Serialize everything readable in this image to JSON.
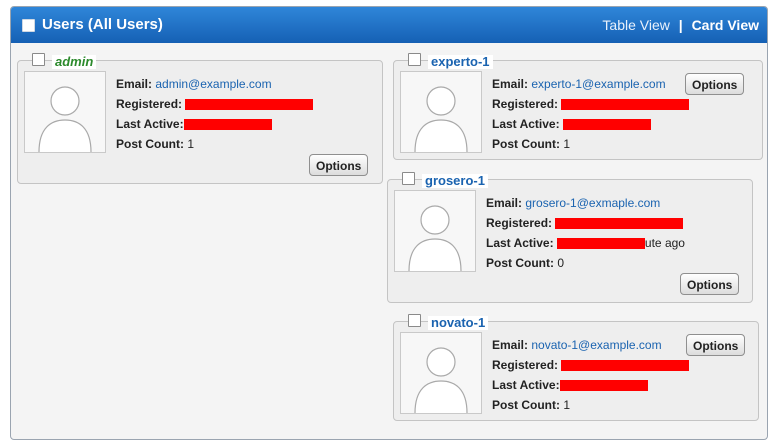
{
  "header": {
    "title": "Users (All Users)",
    "table_view": "Table View",
    "separator": "|",
    "card_view": "Card View"
  },
  "labels": {
    "email": "Email:",
    "registered": "Registered:",
    "last_active": "Last Active:",
    "post_count": "Post Count:",
    "options": "Options"
  },
  "users": [
    {
      "name": "admin",
      "email": "admin@example.com",
      "last_active_tail": "",
      "post_count": "1"
    },
    {
      "name": "experto-1",
      "email": "experto-1@example.com",
      "last_active_tail": "",
      "post_count": "1"
    },
    {
      "name": "grosero-1",
      "email": "grosero-1@exmaple.com",
      "last_active_tail": "ute ago",
      "post_count": "0"
    },
    {
      "name": "novato-1",
      "email": "novato-1@example.com",
      "last_active_tail": "",
      "post_count": "1"
    }
  ],
  "colors": {
    "header": "#1f6fc5",
    "redaction": "#ff0000",
    "admin_name": "#2c8a2c",
    "user_name": "#1a63b0"
  },
  "icons": {
    "avatar": "user-silhouette-icon",
    "checkbox": "checkbox-icon"
  }
}
